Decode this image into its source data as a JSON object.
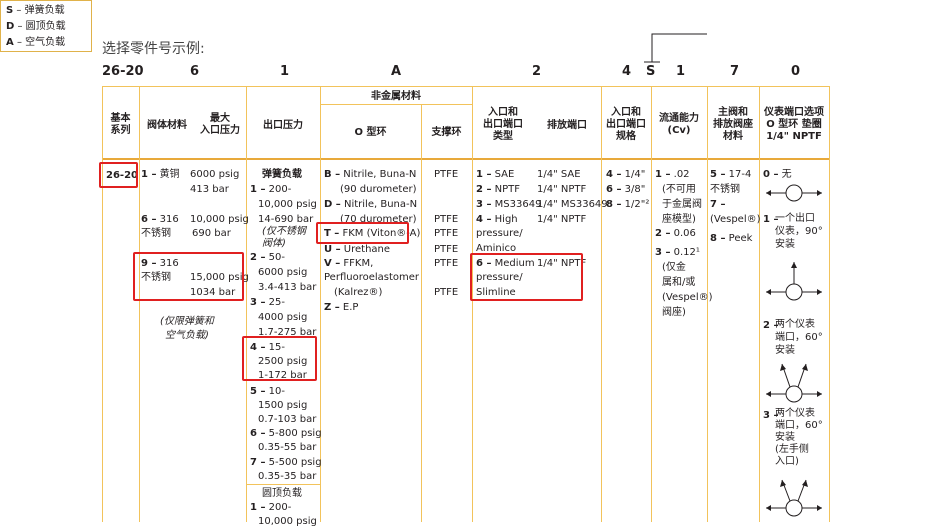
{
  "title": "选择零件号示例:",
  "code": [
    "26-20",
    "6",
    "1",
    "A",
    "2",
    "4",
    "S",
    "1",
    "7",
    "0"
  ],
  "legend": [
    {
      "key": "S",
      "text": "– 弹簧负载"
    },
    {
      "key": "D",
      "text": "– 圆顶负载"
    },
    {
      "key": "A",
      "text": "– 空气负载"
    }
  ],
  "headers": {
    "base": "基本\n系列",
    "body_mat": "阀体材料",
    "max_inlet": "最大\n入口压力",
    "outlet": "出口压力",
    "nonmetal": "非金属材料",
    "oring": "O 型环",
    "backup": "支撑环",
    "inlet_port": "入口和\n出口端口\n类型",
    "vent": "排放端口",
    "port_size": "入口和\n出口端口\n规格",
    "flow": "流通能力\n(Cv)",
    "valve_mat": "主阀和\n排放阀座\n材料",
    "gauge": "仪表端口选项\nO 型环 垫圈\n1/4\" NPTF"
  },
  "base_value": "26-20",
  "body": [
    {
      "n": "1 –",
      "mat": "黄铜",
      "p1": "6000 psig",
      "p2": "413 bar"
    },
    {
      "n": "6 –",
      "mat": "316",
      "mat2": "不锈钢",
      "p1": "10,000 psig",
      "p2": "690 bar"
    },
    {
      "n": "9 –",
      "mat": "316",
      "mat2": "不锈钢",
      "p1": "15,000 psig",
      "p2": "1034 bar"
    }
  ],
  "body_note": "(仅限弹簧和\n空气负载)",
  "outlet_title": "弹簧负载",
  "outlet": [
    {
      "n": "1 –",
      "l1": "200-",
      "l2": "10,000 psig",
      "l3": "14-690 bar",
      "note": "(仅不锈钢\n阀体)"
    },
    {
      "n": "2 –",
      "l1": "50-",
      "l2": "6000 psig",
      "l3": "3.4-413 bar"
    },
    {
      "n": "3 –",
      "l1": "25-",
      "l2": "4000 psig",
      "l3": "1.7-275 bar"
    },
    {
      "n": "4 –",
      "l1": "15-",
      "l2": "2500 psig",
      "l3": "1-172 bar"
    },
    {
      "n": "5 –",
      "l1": "10-",
      "l2": "1500 psig",
      "l3": "0.7-103 bar"
    },
    {
      "n": "6 –",
      "l1": "5-800 psig",
      "l2": "0.35-55 bar"
    },
    {
      "n": "7 –",
      "l1": "5-500 psig",
      "l2": "0.35-35 bar"
    }
  ],
  "outlet_dome_title": "圆顶负载",
  "outlet_dome": [
    {
      "n": "1 –",
      "l1": "200-",
      "l2": "10,000 psig"
    }
  ],
  "orings": [
    {
      "n": "B –",
      "l1": "Nitrile, Buna-N",
      "l2": "(90 durometer)",
      "b": "PTFE"
    },
    {
      "n": "D –",
      "l1": "Nitrile, Buna-N",
      "l2": "(70 durometer)",
      "b": "PTFE"
    },
    {
      "n": "T –",
      "l1": "FKM (Viton®-A)",
      "b": "PTFE"
    },
    {
      "n": "U –",
      "l1": "Urethane",
      "b": "PTFE"
    },
    {
      "n": "V –",
      "l1": "FFKM,",
      "l2": "Perfluoroelastomer",
      "l3": "(Kalrez®)",
      "b": "PTFE"
    },
    {
      "n": "Z –",
      "l1": "E.P",
      "b": "PTFE"
    }
  ],
  "ports": [
    {
      "n": "1 –",
      "t": "SAE",
      "v": "1/4\" SAE"
    },
    {
      "n": "2 –",
      "t": "NPTF",
      "v": "1/4\" NPTF"
    },
    {
      "n": "3 –",
      "t": "MS33649",
      "v": "1/4\" MS33649"
    },
    {
      "n": "4 –",
      "t": "High",
      "t2": "pressure/",
      "t3": "Aminico",
      "v": "1/4\" NPTF"
    },
    {
      "n": "6 –",
      "t": "Medium",
      "t2": "pressure/",
      "t3": "Slimline",
      "v": "1/4\" NPTF"
    }
  ],
  "sizes": [
    {
      "n": "4 –",
      "v": "1/4\""
    },
    {
      "n": "6 –",
      "v": "3/8\""
    },
    {
      "n": "8 –",
      "v": "1/2\"²"
    }
  ],
  "flow": [
    {
      "n": "1 –",
      "v": ".02",
      "note": "(不可用\n于金属阀\n座模型)"
    },
    {
      "n": "2 –",
      "v": "0.06"
    },
    {
      "n": "3 –",
      "v": "0.12¹",
      "note": "(仅金\n属和/或\n(Vespel®)\n阀座)"
    }
  ],
  "valve": [
    {
      "n": "5 –",
      "v": "17-4",
      "v2": "不锈钢"
    },
    {
      "n": "7 –",
      "v": "(Vespel®)"
    },
    {
      "n": "8 –",
      "v": "Peek"
    }
  ],
  "gauge": [
    {
      "n": "0 –",
      "v": "无"
    },
    {
      "n": "1 –",
      "v": "一个出口\n仪表，90°\n安装"
    },
    {
      "n": "2 –",
      "v": "两个仪表\n端口，60°\n安装"
    },
    {
      "n": "3 –",
      "v": "两个仪表\n端口，60°\n安装\n(左手侧\n入口)"
    }
  ]
}
